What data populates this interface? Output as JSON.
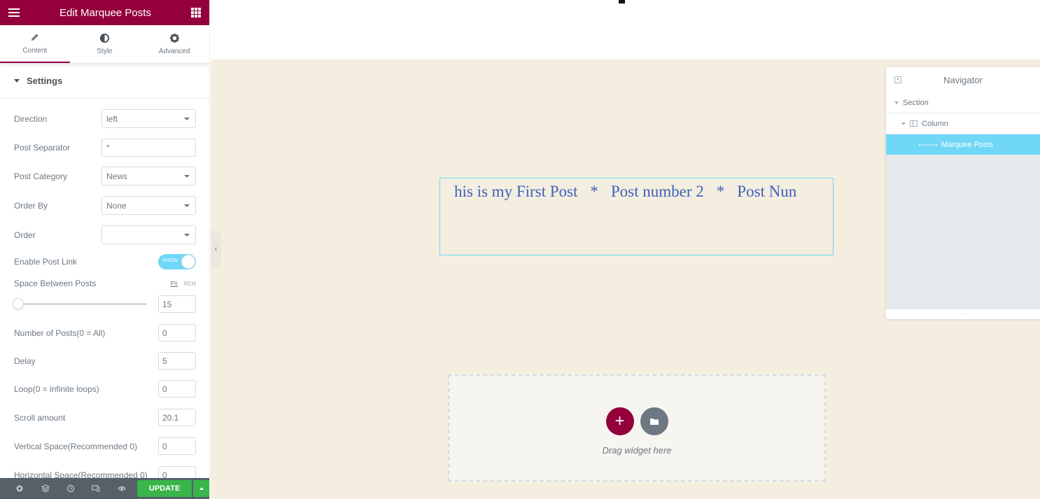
{
  "panel": {
    "title": "Edit Marquee Posts",
    "tabs": [
      {
        "label": "Content",
        "icon": "pencil-icon"
      },
      {
        "label": "Style",
        "icon": "half-circle-icon"
      },
      {
        "label": "Advanced",
        "icon": "gear-icon"
      }
    ],
    "section_title": "Settings",
    "controls": {
      "direction": {
        "label": "Direction",
        "value": "left"
      },
      "post_separator": {
        "label": "Post Separator",
        "value": "*"
      },
      "post_category": {
        "label": "Post Category",
        "value": "News"
      },
      "order_by": {
        "label": "Order By",
        "value": "None"
      },
      "order": {
        "label": "Order",
        "value": ""
      },
      "enable_post_link": {
        "label": "Enable Post Link",
        "toggle_text": "SHOW",
        "on": true
      },
      "space_between": {
        "label": "Space Between Posts",
        "unit_px": "PX",
        "unit_rem": "REM",
        "value": "15"
      },
      "number_of_posts": {
        "label": "Number of Posts(0 = All)",
        "value": "0"
      },
      "delay": {
        "label": "Delay",
        "value": "5"
      },
      "loop": {
        "label": "Loop(0 = infinite loops)",
        "value": "0"
      },
      "scroll_amount": {
        "label": "Scroll amount",
        "value": "20.1"
      },
      "vertical_space": {
        "label": "Vertical Space(Recommended 0)",
        "value": "0"
      },
      "horizontal_space": {
        "label": "Horizontal Space(Recommended 0)",
        "value": "0"
      }
    },
    "footer": {
      "update_label": "UPDATE"
    }
  },
  "canvas": {
    "marquee": {
      "posts": [
        "his is my First Post",
        "Post number 2",
        "Post Nun"
      ],
      "separator": "*"
    },
    "dropzone": {
      "add_label": "+",
      "text": "Drag widget here"
    }
  },
  "navigator": {
    "title": "Navigator",
    "items": {
      "section": "Section",
      "column": "Column",
      "widget": "Marquee Posts"
    },
    "footer_handle": "···"
  },
  "colors": {
    "brand": "#93003c",
    "accent": "#71d7f7",
    "update": "#39b54a",
    "canvas_bg": "#f3eedf",
    "marquee_text": "#3f5fbf"
  }
}
